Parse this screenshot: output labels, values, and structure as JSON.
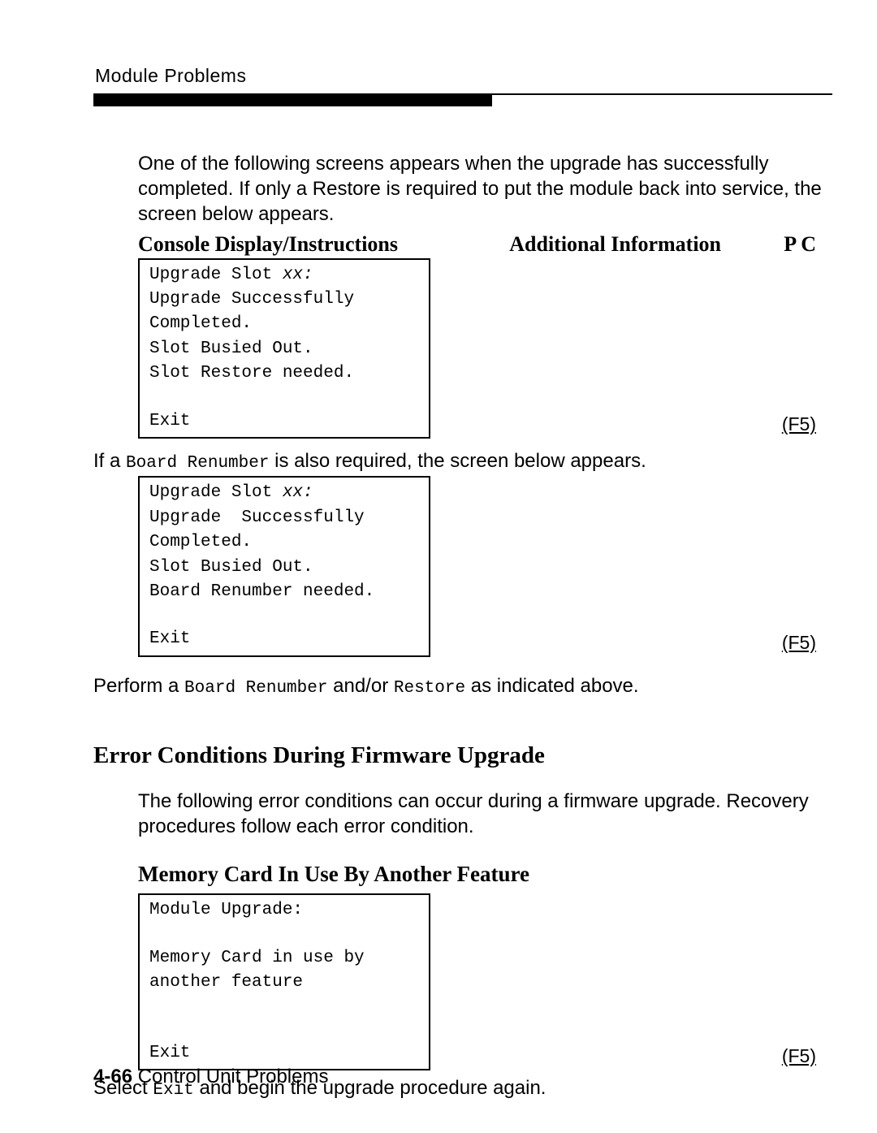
{
  "header": {
    "section": "Module Problems"
  },
  "intro": "One of the following screens appears when the upgrade has successfully completed. If only a Restore is required to put the module back into service, the screen below appears.",
  "console_row": {
    "left": "Console  Display/Instructions",
    "mid": "Additional  Information",
    "right": "P C"
  },
  "screen1": {
    "line1_a": "Upgrade Slot ",
    "line1_b_italic": "xx:",
    "line2": "Upgrade Successfully",
    "line3": "Completed.",
    "line4": "Slot Busied Out.",
    "line5": "Slot Restore needed.",
    "exit": "Exit",
    "key": "(F5)"
  },
  "between1": {
    "pre": "If a ",
    "mono": "Board Renumber",
    "post": "  is also required, the screen below appears."
  },
  "screen2": {
    "line1_a": "Upgrade Slot ",
    "line1_b_italic": "xx:",
    "line2": "Upgrade  Successfully",
    "line3": "Completed.",
    "line4": "Slot Busied Out.",
    "line5": "Board Renumber needed.",
    "exit": "Exit",
    "key": "(F5)"
  },
  "perform": {
    "pre": "Perform a ",
    "mono1": "Board Renumber",
    "mid": "  and/or ",
    "mono2": "Restore",
    "post": "  as indicated above."
  },
  "error_section_title": "Error Conditions During Firmware Upgrade",
  "error_section_body": "The following error conditions can occur during a firmware upgrade. Recovery procedures follow each error condition.",
  "memcard_title": "Memory Card In Use By Another Feature",
  "screen3": {
    "line1": "Module Upgrade:",
    "line3": "Memory Card in use by",
    "line4": "another feature",
    "exit": "Exit",
    "key": "(F5)"
  },
  "select_line": {
    "pre": "Select ",
    "mono": "Exit",
    "post": "  and begin the upgrade procedure again."
  },
  "footer": {
    "page_num": "4-66",
    "label": " Control Unit Problems"
  }
}
